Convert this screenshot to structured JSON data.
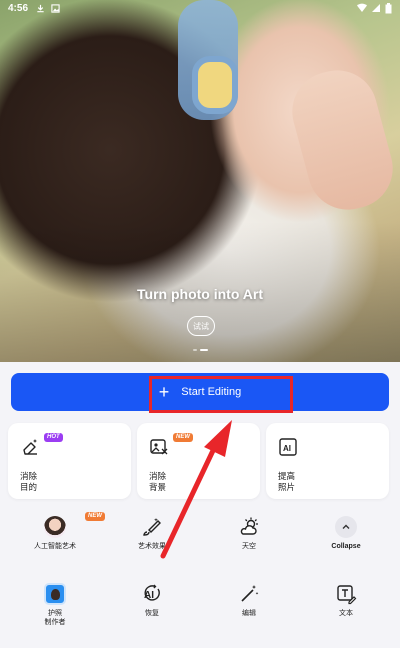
{
  "status_bar": {
    "time": "4:56"
  },
  "hero": {
    "title": "Turn photo into Art",
    "try_label": "试试"
  },
  "start_editing": {
    "label": "Start Editing"
  },
  "feature_cards": [
    {
      "label_line1": "消除",
      "label_line2": "目的",
      "badge": "HOT"
    },
    {
      "label_line1": "消除",
      "label_line2": "背景",
      "badge": "NEW"
    },
    {
      "label_line1": "提高",
      "label_line2": "照片",
      "badge": ""
    }
  ],
  "tools_row1": [
    {
      "label": "人工智能艺术",
      "badge": "NEW"
    },
    {
      "label": "艺术效果"
    },
    {
      "label": "天空"
    },
    {
      "label": "Collapse"
    }
  ],
  "tools_row2": [
    {
      "label_line1": "护照",
      "label_line2": "制作者"
    },
    {
      "label": "恢复"
    },
    {
      "label": "编辑"
    },
    {
      "label": "文本"
    }
  ],
  "colors": {
    "primary": "#1a57f5",
    "highlight": "#e8262a",
    "hot_badge": "#9b3df2",
    "new_badge": "#f07b35"
  }
}
